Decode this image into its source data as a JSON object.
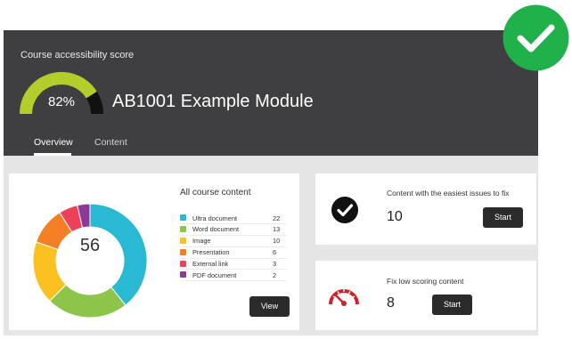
{
  "header": {
    "score_label": "Course accessibility score",
    "score_value": "82%",
    "score_fraction": 0.82,
    "module_title": "AB1001 Example Module",
    "tabs": [
      {
        "label": "Overview",
        "active": true
      },
      {
        "label": "Content",
        "active": false
      }
    ]
  },
  "summary": {
    "total": "56",
    "title": "All course content",
    "items": [
      {
        "label": "Ultra document",
        "count": 22,
        "color": "#2ab9d3"
      },
      {
        "label": "Word document",
        "count": 13,
        "color": "#8dc44a"
      },
      {
        "label": "Image",
        "count": 10,
        "color": "#fbc120"
      },
      {
        "label": "Presentation",
        "count": 6,
        "color": "#f47f25"
      },
      {
        "label": "External link",
        "count": 3,
        "color": "#ee4157"
      },
      {
        "label": "PDF document",
        "count": 2,
        "color": "#8c3a96"
      }
    ],
    "view_button": "View"
  },
  "easy_issues": {
    "text": "Content with the easiest issues to fix",
    "count": "10",
    "button": "Start",
    "icon": "check-circle-icon"
  },
  "low_scoring": {
    "text": "Fix low scoring content",
    "count": "8",
    "button": "Start",
    "icon": "speedometer-icon"
  },
  "colors": {
    "header_bg": "#3f3f41",
    "gauge_fill": "#b4cd2b",
    "gauge_track": "#111111",
    "badge": "#20b14b",
    "low_score_red": "#d0202a"
  }
}
